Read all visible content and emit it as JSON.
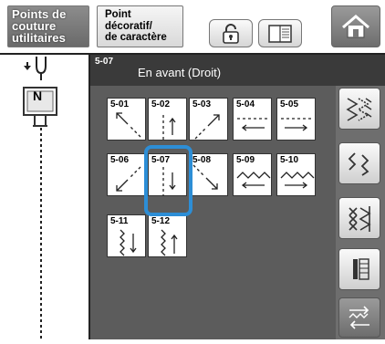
{
  "tabs": {
    "utility_label": "Points de\ncouture\nutilitaires",
    "decorative_label": "Point\ndécoratif/\nde caractère"
  },
  "header": {
    "code": "5-07",
    "title": "En avant (Droit)"
  },
  "presser_foot_label": "N",
  "selected_stitch": "5-07",
  "stitches": [
    {
      "num": "5-01",
      "icon": "diagonal-up-left-arrow-icon"
    },
    {
      "num": "5-02",
      "icon": "up-arrow-icon"
    },
    {
      "num": "5-03",
      "icon": "diagonal-up-right-arrow-icon"
    },
    {
      "num": "5-04",
      "icon": "left-arrow-icon"
    },
    {
      "num": "5-05",
      "icon": "right-arrow-icon"
    },
    {
      "num": "5-06",
      "icon": "diagonal-down-left-arrow-icon"
    },
    {
      "num": "5-07",
      "icon": "down-arrow-icon"
    },
    {
      "num": "5-08",
      "icon": "diagonal-down-right-arrow-icon"
    },
    {
      "num": "5-09",
      "icon": "zigzag-left-arrow-icon"
    },
    {
      "num": "5-10",
      "icon": "zigzag-right-arrow-icon"
    },
    {
      "num": "5-11",
      "icon": "zigzag-down-arrow-icon"
    },
    {
      "num": "5-12",
      "icon": "zigzag-up-arrow-icon"
    }
  ],
  "colors": {
    "selection": "#2d8ed6",
    "panel_bg": "#5c5c5c",
    "header_bg": "#3a3a3a"
  }
}
